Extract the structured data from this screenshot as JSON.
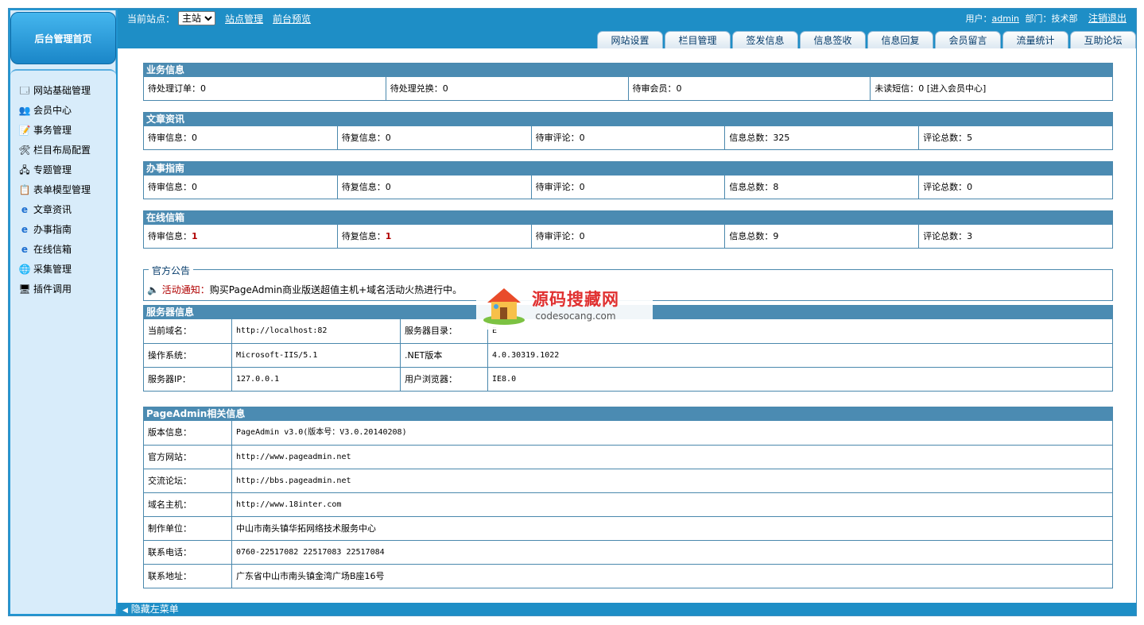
{
  "sidebar": {
    "home": "后台管理首页",
    "items": [
      {
        "label": "网站基础管理",
        "icon": "site-icon"
      },
      {
        "label": "会员中心",
        "icon": "members-icon"
      },
      {
        "label": "事务管理",
        "icon": "tasks-icon"
      },
      {
        "label": "栏目布局配置",
        "icon": "tools-icon"
      },
      {
        "label": "专题管理",
        "icon": "topics-icon"
      },
      {
        "label": "表单模型管理",
        "icon": "form-icon"
      },
      {
        "label": "文章资讯",
        "icon": "ie-icon"
      },
      {
        "label": "办事指南",
        "icon": "ie-icon"
      },
      {
        "label": "在线信箱",
        "icon": "ie-icon"
      },
      {
        "label": "采集管理",
        "icon": "globe-icon"
      },
      {
        "label": "插件调用",
        "icon": "computer-icon"
      }
    ]
  },
  "header": {
    "site_label": "当前站点：",
    "site_value": "主站",
    "site_manage": "站点管理",
    "preview": "前台预览",
    "user_label": "用户：",
    "user": "admin",
    "dept": "部门：技术部",
    "logout": "注销退出",
    "tabs": [
      "网站设置",
      "栏目管理",
      "签发信息",
      "信息签收",
      "信息回复",
      "会员留言",
      "流量统计",
      "互助论坛"
    ]
  },
  "business": {
    "title": "业务信息",
    "cells": [
      "待处理订单：0",
      "待处理兑换：0",
      "待审会员：0",
      "未读短信：0 [进入会员中心]"
    ]
  },
  "articles": {
    "title": "文章资讯",
    "cells": [
      "待审信息：0",
      "待复信息：0",
      "待审评论：0",
      "信息总数：325",
      "评论总数：5"
    ]
  },
  "guide": {
    "title": "办事指南",
    "cells": [
      "待审信息：0",
      "待复信息：0",
      "待审评论：0",
      "信息总数：8",
      "评论总数：0"
    ]
  },
  "mailbox": {
    "title": "在线信箱",
    "c1_label": "待审信息：",
    "c1_value": "1",
    "c2_label": "待复信息：",
    "c2_value": "1",
    "c3": "待审评论：0",
    "c4": "信息总数：9",
    "c5": "评论总数：3"
  },
  "notice": {
    "legend": "官方公告",
    "label": "活动通知：",
    "text": "购买PageAdmin商业版送超值主机+域名活动火热进行中。"
  },
  "server": {
    "title": "服务器信息",
    "domain_label": "当前域名：",
    "domain": "http://localhost:82",
    "dir_label": "服务器目录：",
    "dir": "E",
    "os_label": "操作系统：",
    "os": "Microsoft-IIS/5.1",
    "net_label": ".NET版本",
    "net": "4.0.30319.1022",
    "ip_label": "服务器IP：",
    "ip": "127.0.0.1",
    "browser_label": "用户浏览器：",
    "browser": "IE8.0"
  },
  "about": {
    "title": "PageAdmin相关信息",
    "rows": [
      {
        "k": "版本信息：",
        "v": "PageAdmin v3.0(版本号：V3.0.20140208)"
      },
      {
        "k": "官方网站：",
        "v": "http://www.pageadmin.net"
      },
      {
        "k": "交流论坛：",
        "v": "http://bbs.pageadmin.net"
      },
      {
        "k": "域名主机：",
        "v": "http://www.18inter.com"
      },
      {
        "k": "制作单位：",
        "v": "中山市南头镇华拓网络技术服务中心"
      },
      {
        "k": "联系电话：",
        "v": "0760-22517082 22517083 22517084"
      },
      {
        "k": "联系地址：",
        "v": "广东省中山市南头镇金湾广场B座16号"
      }
    ]
  },
  "footer": {
    "hide_menu": "隐藏左菜单"
  },
  "watermark": {
    "cn": "源码搜藏网",
    "en": "codesocang.com"
  }
}
